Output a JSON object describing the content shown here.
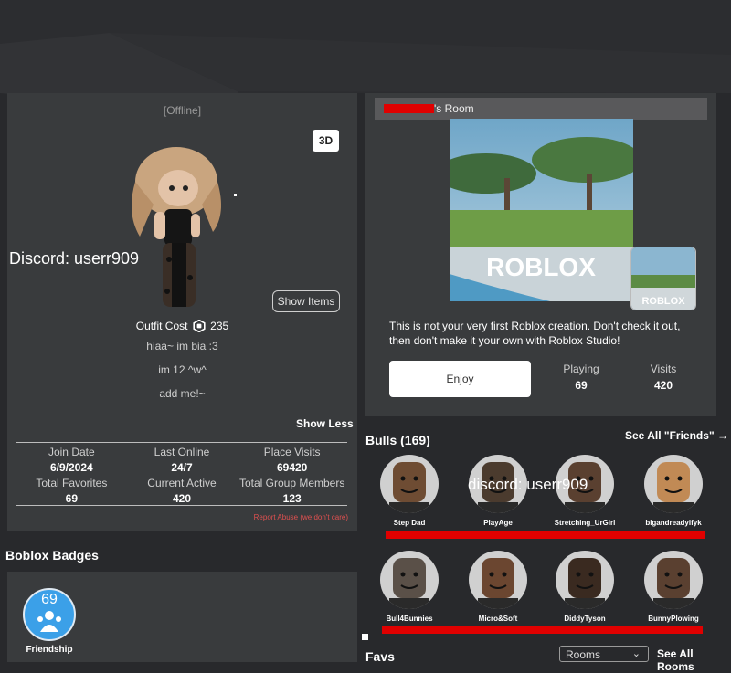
{
  "profile": {
    "status": "[Offline]",
    "btn_3d": "3D",
    "show_items": "Show Items",
    "outfit_cost_label": "Outfit Cost",
    "outfit_cost_value": "235",
    "bio_lines": [
      "hiaa~ im bia :3",
      "",
      "im 12 ^w^",
      "",
      "add me!~"
    ],
    "show_less": "Show Less",
    "stats": [
      {
        "label": "Join Date",
        "value": "6/9/2024"
      },
      {
        "label": "Last Online",
        "value": "24/7"
      },
      {
        "label": "Place Visits",
        "value": "69420"
      },
      {
        "label": "Total Favorites",
        "value": "69"
      },
      {
        "label": "Current Active",
        "value": "420"
      },
      {
        "label": "Total Group Members",
        "value": "123"
      }
    ],
    "report_abuse": "Report Abuse (we don't care)"
  },
  "overlay": {
    "discord_left": "Discord: userr909",
    "discord_right": "discord: userr909"
  },
  "badges": {
    "title": "Boblox Badges",
    "items": [
      {
        "number": "69",
        "label": "Friendship"
      }
    ]
  },
  "room": {
    "title_suffix": "'s Room",
    "logo_text": "ROBLOX",
    "mini_logo_text": "ROBLOX",
    "description": "This is not your very first Roblox creation. Don't check it out, then don't make it your own with Roblox Studio!",
    "play_button": "Enjoy",
    "playing_label": "Playing",
    "playing_value": "69",
    "visits_label": "Visits",
    "visits_value": "420"
  },
  "friends": {
    "title": "Bulls (169)",
    "see_all": "See All \"Friends\" →",
    "items": [
      {
        "name": "Step Dad",
        "skin": "#6e4c33"
      },
      {
        "name": "PlayAge",
        "skin": "#4b3b2e"
      },
      {
        "name": "Stretching_UrGirl",
        "skin": "#5a4030"
      },
      {
        "name": "bigandreadyifyk",
        "skin": "#c18a55"
      },
      {
        "name": "Bull4Bunnies",
        "skin": "#5a5048"
      },
      {
        "name": "Micro&Soft",
        "skin": "#6b4630"
      },
      {
        "name": "DiddyTyson",
        "skin": "#3a2a20"
      },
      {
        "name": "BunnyPlowing",
        "skin": "#5a4030"
      }
    ]
  },
  "favs": {
    "title": "Favs",
    "select_value": "Rooms",
    "see_all": "See All Rooms"
  },
  "colors": {
    "panel": "#393b3d",
    "background": "#28292c",
    "redaction": "#e00000",
    "badge_blue": "#3ba0e8"
  }
}
